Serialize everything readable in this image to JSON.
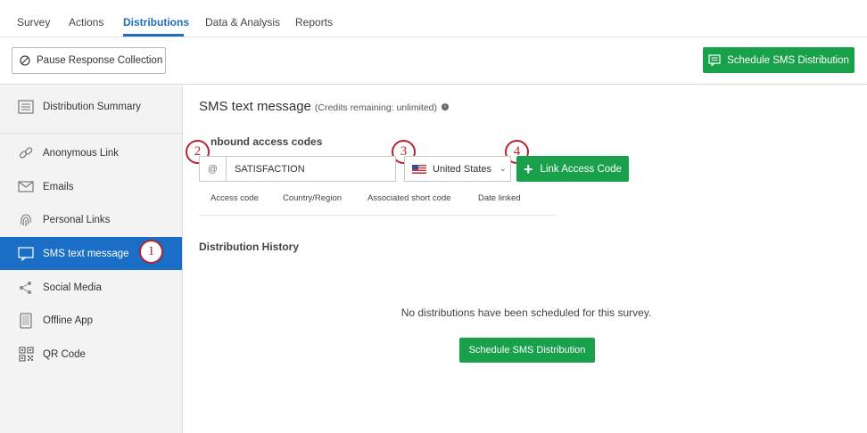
{
  "nav": {
    "tabs": [
      {
        "label": "Survey"
      },
      {
        "label": "Actions"
      },
      {
        "label": "Distributions"
      },
      {
        "label": "Data & Analysis"
      },
      {
        "label": "Reports"
      }
    ],
    "active_tab": "Distributions"
  },
  "toolbar": {
    "pause_label": "Pause Response Collection",
    "schedule_label": "Schedule SMS Distribution"
  },
  "sidebar": {
    "items": [
      {
        "label": "Distribution Summary",
        "icon": "summary-icon"
      },
      {
        "label": "Anonymous Link",
        "icon": "link-icon"
      },
      {
        "label": "Emails",
        "icon": "envelope-icon"
      },
      {
        "label": "Personal Links",
        "icon": "fingerprint-icon"
      },
      {
        "label": "SMS text message",
        "icon": "chat-icon"
      },
      {
        "label": "Social Media",
        "icon": "share-icon"
      },
      {
        "label": "Offline App",
        "icon": "tablet-icon"
      },
      {
        "label": "QR Code",
        "icon": "qr-code-icon"
      }
    ],
    "active_item": "SMS text message"
  },
  "markers": [
    "1",
    "2",
    "3",
    "4"
  ],
  "main": {
    "title": "SMS text message",
    "credits": "(Credits remaining: unlimited)",
    "inbound_heading": "nbound access codes",
    "at_symbol": "@",
    "access_code_value": "SATISFACTION",
    "country_value": "United States",
    "link_button_label": "Link Access Code",
    "columns": [
      "Access code",
      "Country/Region",
      "Associated short code",
      "Date linked"
    ],
    "history_heading": "Distribution History",
    "empty_message": "No distributions have been scheduled for this survey.",
    "schedule_button_label": "Schedule SMS Distribution"
  },
  "colors": {
    "accent_blue": "#1a6ec6",
    "green": "#19a04a",
    "marker_red": "#b3262d"
  }
}
